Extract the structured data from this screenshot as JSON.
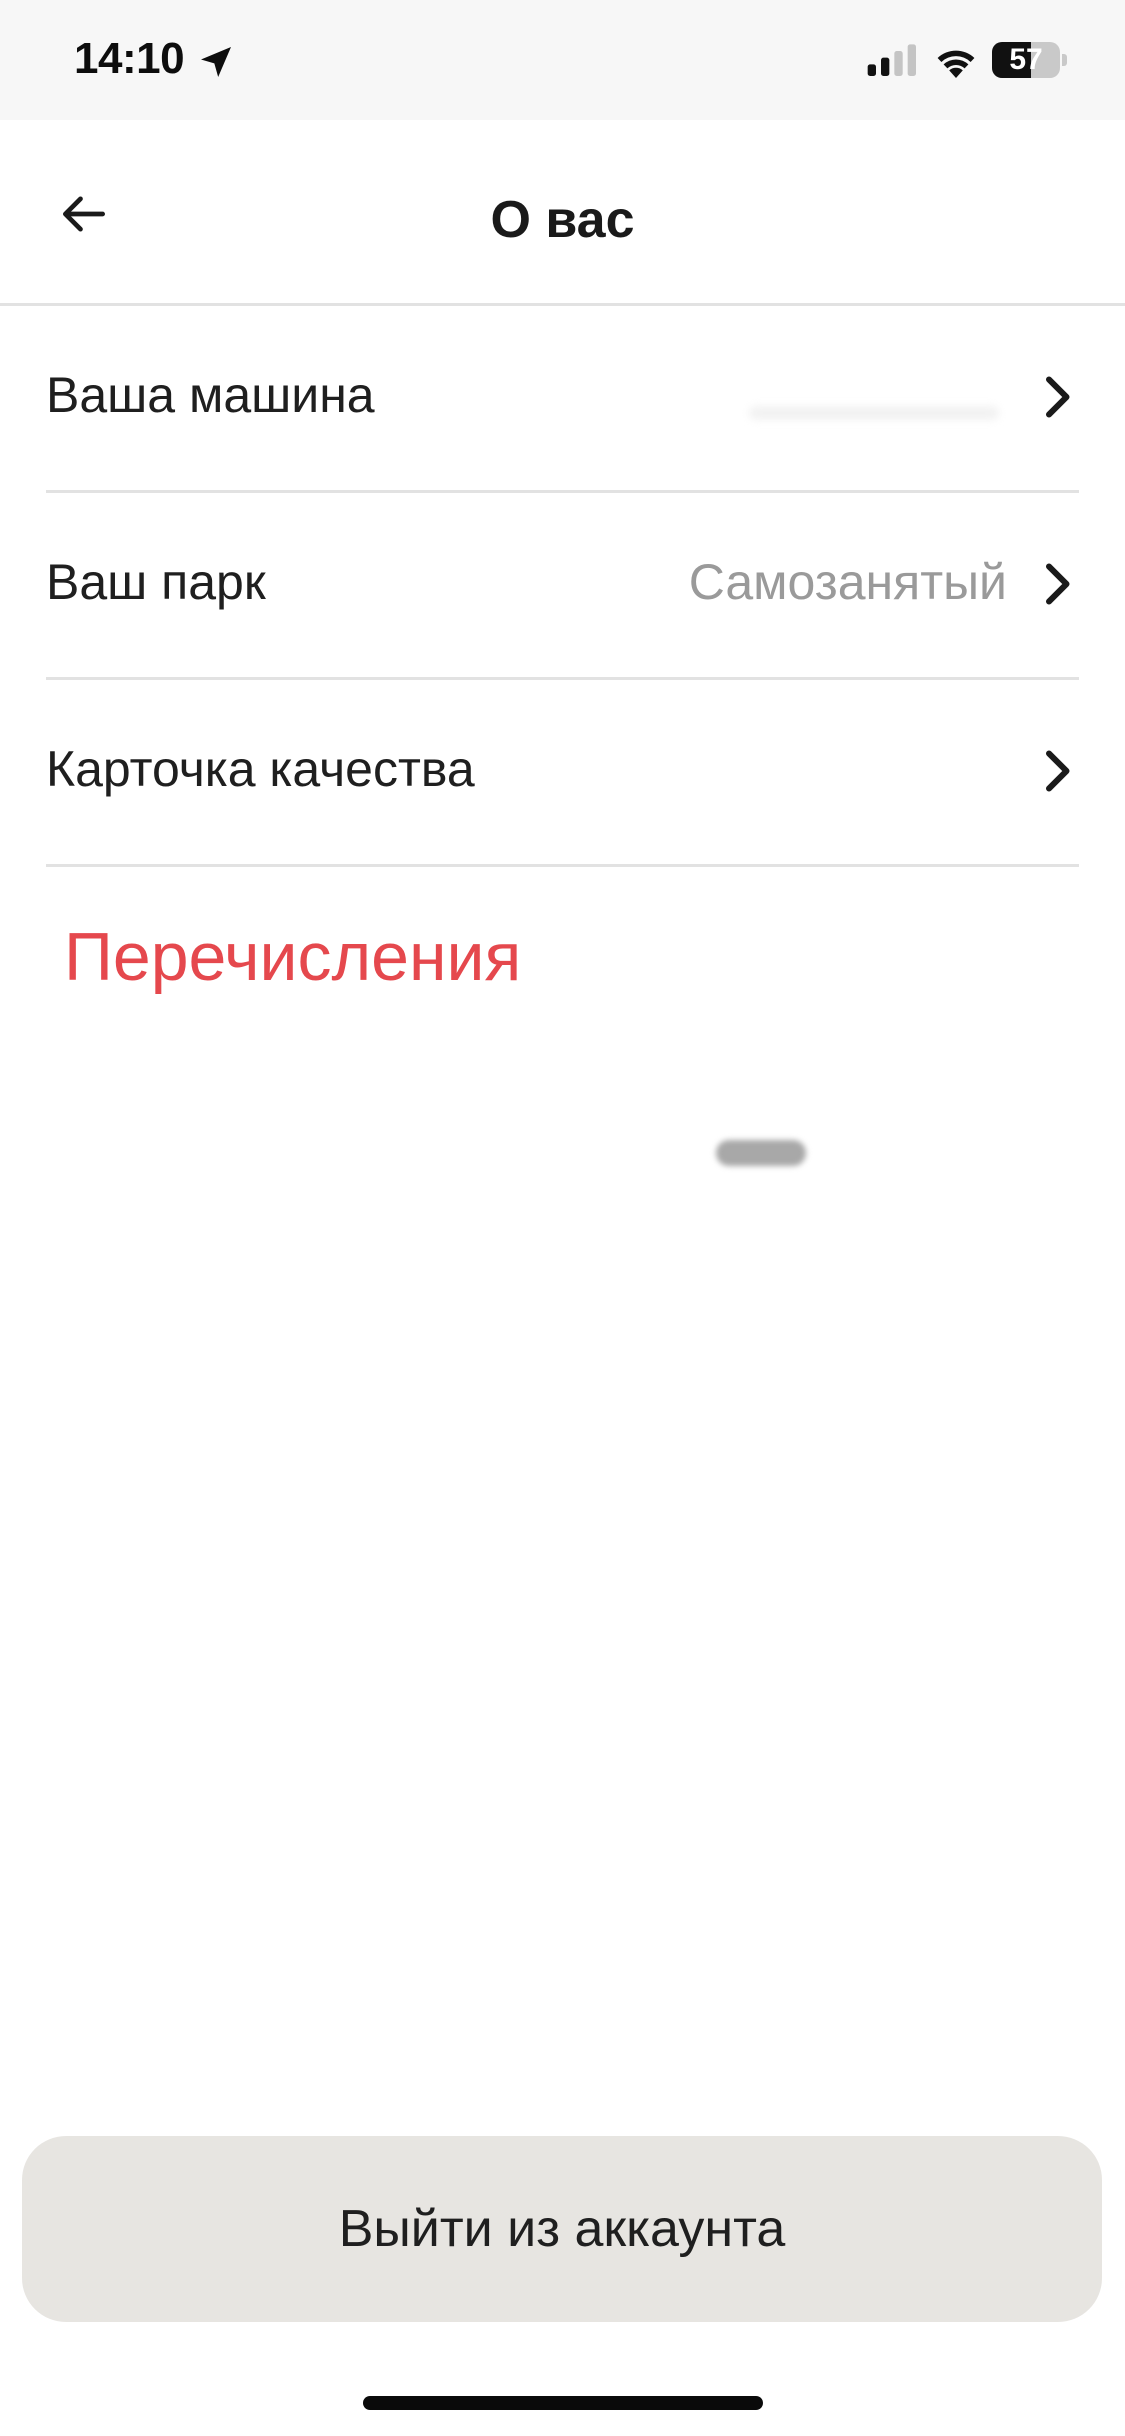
{
  "status_bar": {
    "time": "14:10",
    "battery_level": "57",
    "battery_fraction": 0.57,
    "icons": [
      "location-arrow-icon",
      "cellular-signal-icon",
      "wifi-icon",
      "battery-icon"
    ]
  },
  "header": {
    "title": "О вас",
    "back_icon": "arrow-left-icon"
  },
  "menu": {
    "items": [
      {
        "label": "Ваша машина",
        "value": ""
      },
      {
        "label": "Ваш парк",
        "value": "Самозанятый"
      },
      {
        "label": "Карточка качества",
        "value": ""
      }
    ],
    "chevron_icon": "chevron-right-icon"
  },
  "payouts": {
    "label": "Перечисления"
  },
  "footer": {
    "logout_label": "Выйти из аккаунта"
  },
  "colors": {
    "accent_red": "#e5484d",
    "button_bg": "#e7e5e1",
    "divider": "#e2e2e2",
    "secondary_text": "#9a9a9a"
  }
}
